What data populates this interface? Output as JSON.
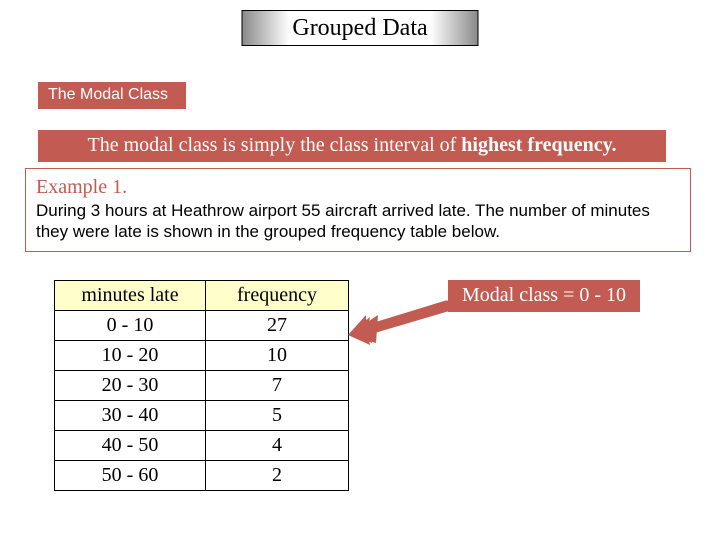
{
  "title": "Grouped Data",
  "subtitle": "The Modal Class",
  "definition": {
    "prefix": "The modal class is simply the class interval of ",
    "bold": "highest frequency."
  },
  "example": {
    "label": "Example 1.",
    "text": "During 3 hours at Heathrow airport 55 aircraft arrived late.  The number of minutes they were late is shown in the grouped frequency table below."
  },
  "table": {
    "headers": {
      "col1": "minutes late",
      "col2": "frequency"
    },
    "rows": [
      {
        "range": "0 - 10",
        "freq": "27"
      },
      {
        "range": "10 - 20",
        "freq": "10"
      },
      {
        "range": "20 - 30",
        "freq": "7"
      },
      {
        "range": "30 - 40",
        "freq": "5"
      },
      {
        "range": "40 - 50",
        "freq": "4"
      },
      {
        "range": "50 - 60",
        "freq": "2"
      }
    ]
  },
  "callout": "Modal class = 0 - 10"
}
